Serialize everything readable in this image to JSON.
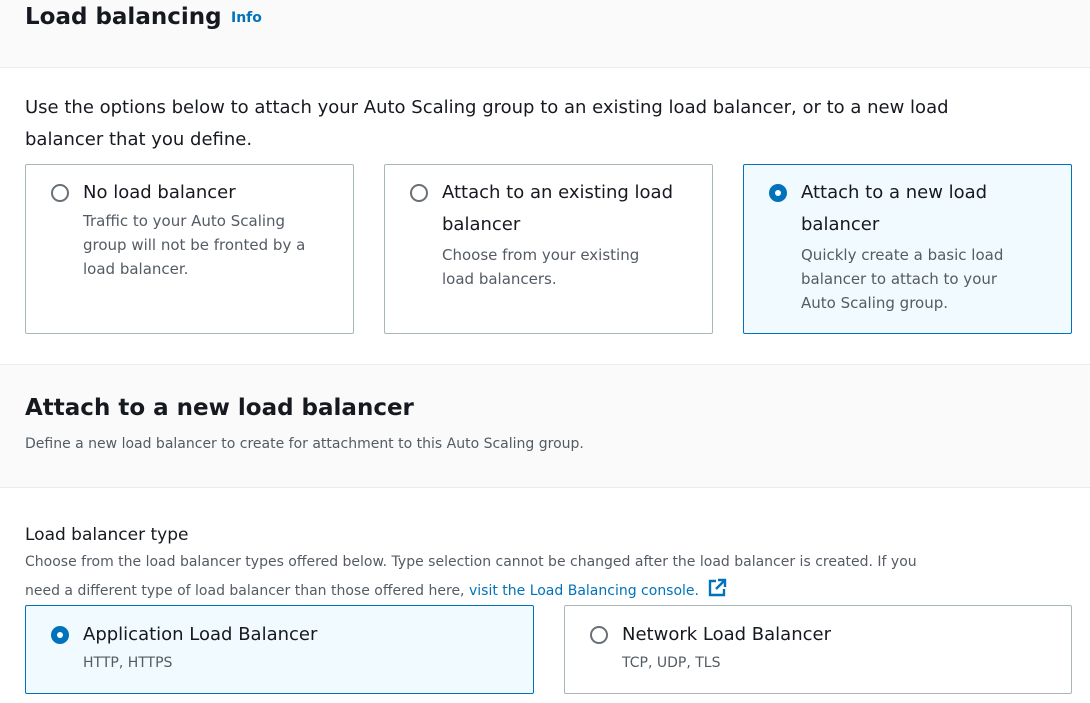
{
  "load_balancing": {
    "title": "Load balancing",
    "info_label": "Info",
    "intro_line1": "Use the options below to attach your Auto Scaling group to an existing load balancer, or to a new load",
    "intro_line2": "balancer that you define.",
    "options": [
      {
        "title_line1": "No load balancer",
        "title_line2": "",
        "desc_line1": "Traffic to your Auto Scaling",
        "desc_line2": "group will not be fronted by a",
        "desc_line3": "load balancer.",
        "selected": false
      },
      {
        "title_line1": "Attach to an existing load",
        "title_line2": "balancer",
        "desc_line1": "Choose from your existing",
        "desc_line2": "load balancers.",
        "desc_line3": "",
        "selected": false
      },
      {
        "title_line1": "Attach to a new load",
        "title_line2": "balancer",
        "desc_line1": "Quickly create a basic load",
        "desc_line2": "balancer to attach to your",
        "desc_line3": "Auto Scaling group.",
        "selected": true
      }
    ]
  },
  "new_lb": {
    "title": "Attach to a new load balancer",
    "description": "Define a new load balancer to create for attachment to this Auto Scaling group.",
    "type_label": "Load balancer type",
    "type_desc_line1": "Choose from the load balancer types offered below. Type selection cannot be changed after the load balancer is created. If you",
    "type_desc_line2": "need a different type of load balancer than those offered here,",
    "console_link": "visit the Load Balancing console.",
    "types": [
      {
        "title": "Application Load Balancer",
        "desc": "HTTP, HTTPS",
        "selected": true
      },
      {
        "title": "Network Load Balancer",
        "desc": "TCP, UDP, TLS",
        "selected": false
      }
    ]
  },
  "colors": {
    "accent": "#0073bb",
    "selected_bg": "#f1faff",
    "border": "#aab7b8",
    "header_bg": "#fafafa"
  }
}
